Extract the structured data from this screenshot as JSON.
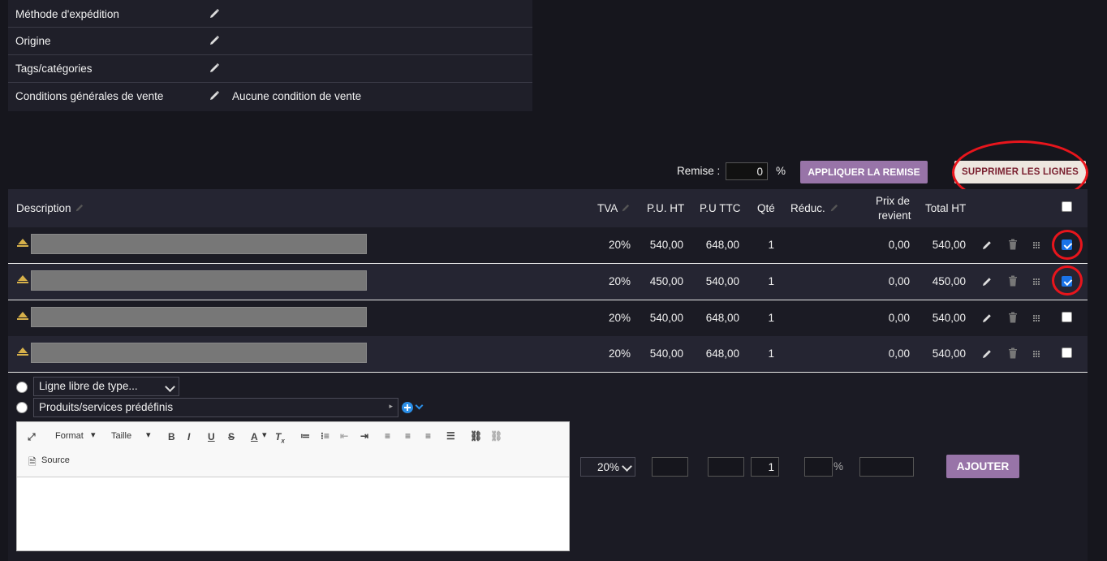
{
  "info": {
    "rows": [
      {
        "label": "Méthode d'expédition",
        "value": ""
      },
      {
        "label": "Origine",
        "value": ""
      },
      {
        "label": "Tags/catégories",
        "value": ""
      },
      {
        "label": "Conditions générales de vente",
        "value": "Aucune condition de vente"
      }
    ]
  },
  "remise": {
    "label": "Remise :",
    "value": "0",
    "unit": "%",
    "apply_label": "APPLIQUER LA REMISE",
    "delete_label": "SUPPRIMER LES LIGNES"
  },
  "table": {
    "headers": {
      "description": "Description",
      "tva": "TVA",
      "pu_ht": "P.U. HT",
      "pu_ttc": "P.U TTC",
      "qte": "Qté",
      "reduc": "Réduc.",
      "prix_revient_1": "Prix de",
      "prix_revient_2": "revient",
      "total_ht": "Total HT"
    },
    "rows": [
      {
        "tva": "20%",
        "pu_ht": "540,00",
        "pu_ttc": "648,00",
        "qte": "1",
        "reduc": "",
        "prix_revient": "0,00",
        "total_ht": "540,00",
        "checked": true
      },
      {
        "tva": "20%",
        "pu_ht": "450,00",
        "pu_ttc": "540,00",
        "qte": "1",
        "reduc": "",
        "prix_revient": "0,00",
        "total_ht": "450,00",
        "checked": true
      },
      {
        "tva": "20%",
        "pu_ht": "540,00",
        "pu_ttc": "648,00",
        "qte": "1",
        "reduc": "",
        "prix_revient": "0,00",
        "total_ht": "540,00",
        "checked": false
      },
      {
        "tva": "20%",
        "pu_ht": "540,00",
        "pu_ttc": "648,00",
        "qte": "1",
        "reduc": "",
        "prix_revient": "0,00",
        "total_ht": "540,00",
        "checked": false
      }
    ]
  },
  "add_line": {
    "free_line_select": "Ligne libre de type...",
    "predefined_select": "Produits/services prédéfinis",
    "editor": {
      "format_label": "Format",
      "size_label": "Taille",
      "source_label": "Source"
    },
    "vat_select": "20%",
    "qty_value": "1",
    "pct_unit": "%",
    "add_label": "AJOUTER"
  },
  "colors": {
    "accent": "#9874a8",
    "highlight_ring": "#e8151c",
    "check_blue": "#1a73e8"
  }
}
